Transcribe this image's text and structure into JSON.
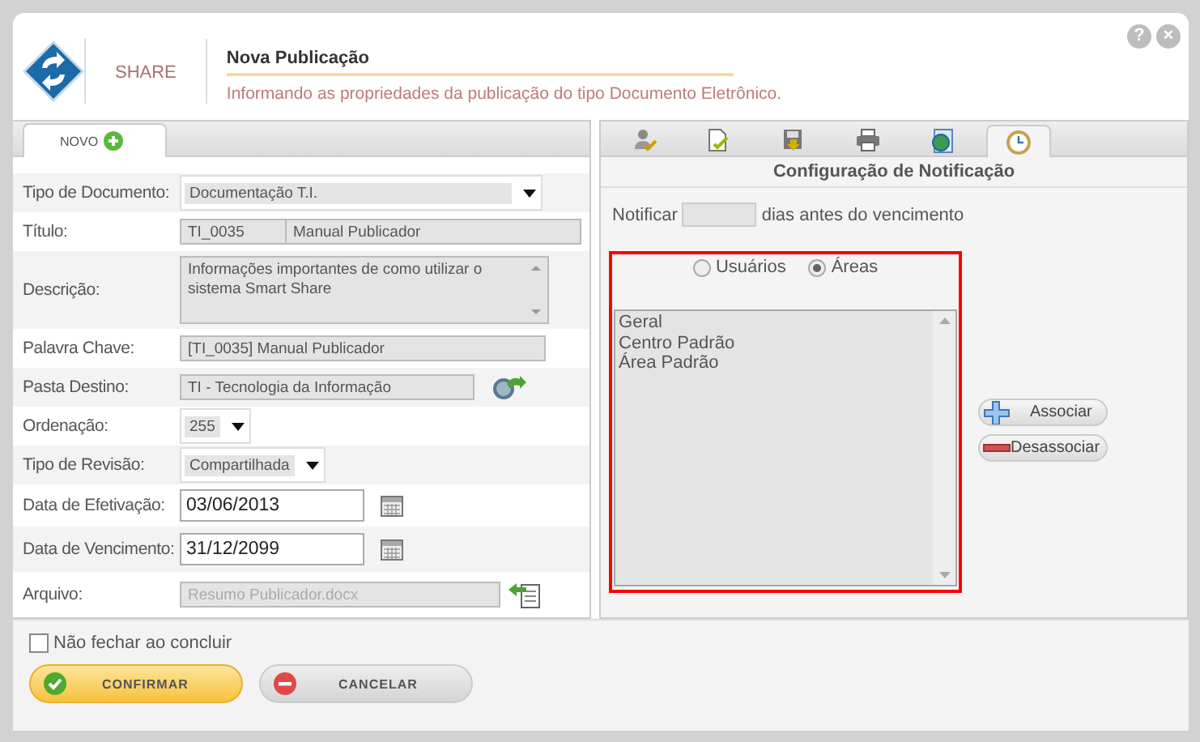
{
  "header": {
    "brand": "SHARE",
    "title": "Nova Publicação",
    "subtitle": "Informando as propriedades da publicação do tipo Documento Eletrônico.",
    "help": "?",
    "close": "×"
  },
  "left_panel": {
    "tabs": [
      {
        "label": "NOVO",
        "selected": true
      }
    ],
    "fields": [
      {
        "label": "Tipo de Documento:",
        "kind": "select-wide",
        "value": "Documentação T.I."
      },
      {
        "label": "Título:",
        "kind": "pair",
        "values": [
          "TI_0035",
          "Manual Publicador"
        ]
      },
      {
        "label": "Descrição:",
        "kind": "textarea",
        "value": "Informações importantes de como utilizar o sistema Smart Share"
      },
      {
        "label": "Palavra Chave:",
        "kind": "text",
        "value": "[TI_0035] Manual Publicador"
      },
      {
        "label": "Pasta Destino:",
        "kind": "folder",
        "value": "TI - Tecnologia da Informação"
      },
      {
        "label": "Ordenação:",
        "kind": "select",
        "value": "255"
      },
      {
        "label": "Tipo de Revisão:",
        "kind": "select",
        "value": "Compartilhada"
      },
      {
        "label": "Data de Efetivação:",
        "kind": "date",
        "value": "03/06/2013"
      },
      {
        "label": "Data de Vencimento:",
        "kind": "date",
        "value": "31/12/2099"
      },
      {
        "label": "Arquivo:",
        "kind": "file",
        "value": "Resumo Publicador.docx",
        "disabled": true
      }
    ]
  },
  "right_panel": {
    "tabs": [
      {
        "kind": "user",
        "selected": false
      },
      {
        "kind": "document",
        "selected": false
      },
      {
        "kind": "disk",
        "selected": false
      },
      {
        "kind": "printer",
        "selected": false
      },
      {
        "kind": "globe",
        "selected": false
      },
      {
        "kind": "clock",
        "selected": true
      }
    ],
    "heading": "Configuração de Notificação",
    "notify": {
      "before": "Notificar",
      "after": "dias antes do vencimento"
    },
    "radios": [
      {
        "label": "Usuários",
        "selected": false
      },
      {
        "label": "Áreas",
        "selected": true
      }
    ],
    "list": [
      "Geral",
      "Centro Padrão",
      "Área Padrão"
    ],
    "buttons": [
      {
        "label": "Associar",
        "kind": "add"
      },
      {
        "label": "Desassociar",
        "kind": "remove"
      }
    ]
  },
  "footer": {
    "checkbox": {
      "label": "Não fechar ao concluir",
      "checked": false
    },
    "buttons": [
      {
        "label": "CONFIRMAR",
        "kind": "confirm"
      },
      {
        "label": "CANCELAR",
        "kind": "cancel"
      }
    ]
  }
}
